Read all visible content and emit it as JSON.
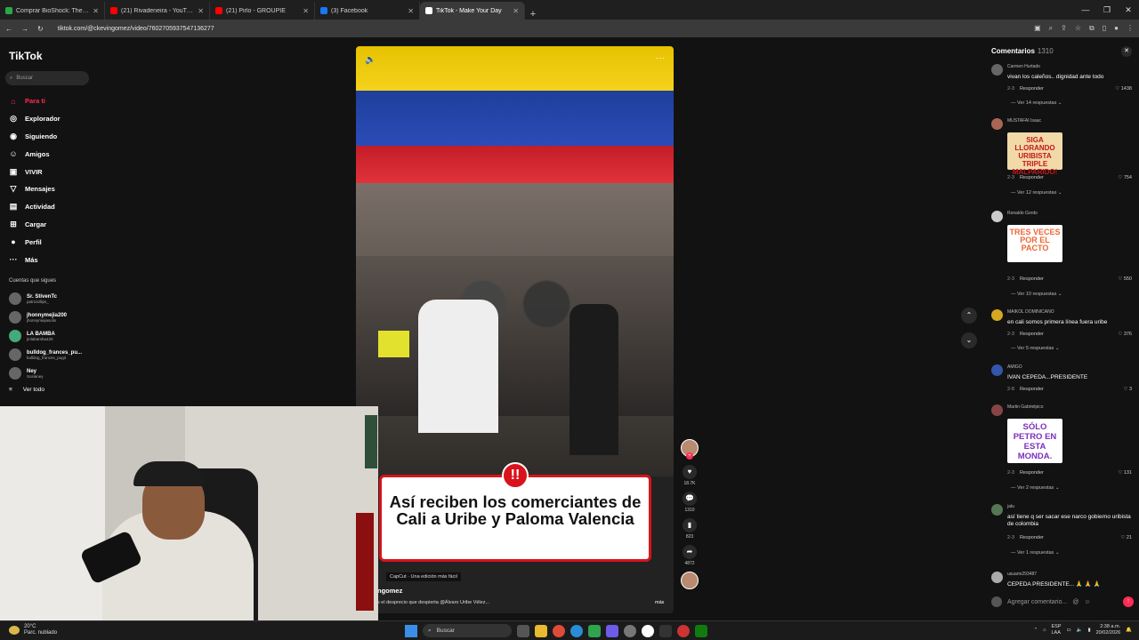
{
  "browser": {
    "tabs": [
      {
        "label": "Comprar BioShock: The Collection",
        "color": "#2aa845"
      },
      {
        "label": "(21) Rivadeneira - YouTube",
        "color": "#ff0000"
      },
      {
        "label": "(21) Pirlo - GROUPIE",
        "color": "#ff0000"
      },
      {
        "label": "(3) Facebook",
        "color": "#1877f2"
      },
      {
        "label": "TikTok - Make Your Day",
        "color": "#ffffff"
      }
    ],
    "url": "tiktok.com/@ckevingomez/video/7602705937547136277"
  },
  "sidebar": {
    "logo": "TikTok",
    "search_placeholder": "Buscar",
    "nav": [
      {
        "label": "Para ti",
        "icon": "home-icon",
        "glyph": "⌂"
      },
      {
        "label": "Explorador",
        "icon": "compass-icon",
        "glyph": "◎"
      },
      {
        "label": "Siguiendo",
        "icon": "following-icon",
        "glyph": "◉"
      },
      {
        "label": "Amigos",
        "icon": "friends-icon",
        "glyph": "☺"
      },
      {
        "label": "VIVIR",
        "icon": "live-icon",
        "glyph": "▣"
      },
      {
        "label": "Mensajes",
        "icon": "messages-icon",
        "glyph": "▽"
      },
      {
        "label": "Actividad",
        "icon": "activity-icon",
        "glyph": "▤"
      },
      {
        "label": "Cargar",
        "icon": "upload-icon",
        "glyph": "⊞"
      },
      {
        "label": "Perfil",
        "icon": "profile-icon",
        "glyph": "●"
      },
      {
        "label": "Más",
        "icon": "more-icon",
        "glyph": "···"
      }
    ],
    "following_header": "Cuentas que sigues",
    "following": [
      {
        "name": "Sr. StivenTc",
        "handle": "patriciollips_"
      },
      {
        "name": "jhonnymejia200",
        "handle": "jhonnymejiasolis"
      },
      {
        "name": "LA BAMBA",
        "handle": "jmlabamba420"
      },
      {
        "name": "bulldog_frances_pu...",
        "handle": "bulldog_frances_pug3"
      },
      {
        "name": "Ney",
        "handle": "Sosianey"
      }
    ],
    "see_all": "Ver todo"
  },
  "video": {
    "caption": "Así reciben los comerciantes de Cali a Uribe y Paloma Valencia",
    "alert": "!!",
    "capcut": "CapCut · Una edición más fácil",
    "username": "ngomez",
    "description": "s el desprecio que despierta @Álvaro Uribe Vélez...",
    "more": "más"
  },
  "actions": {
    "likes": "18.7K",
    "comments": "1310",
    "saves": "823",
    "shares": "4872"
  },
  "comments": {
    "title": "Comentarios",
    "count": "1310",
    "items": [
      {
        "user": "Carmen Hurtado",
        "text": "vivan los caleños.. dignidad ante todo",
        "date": "2-3",
        "reply": "Responder",
        "likes": "1438",
        "replies": "Ver 14 respuestas"
      },
      {
        "user": "MUSTAFAI Isaac",
        "sticker": "SIGA LLORANDO URIBISTA TRIPLE MALPARIDO!",
        "date": "2-3",
        "reply": "Responder",
        "likes": "754",
        "replies": "Ver 12 respuestas"
      },
      {
        "user": "Ronaldo Gordo",
        "sticker": "TRES VECES POR EL PACTO",
        "date": "2-3",
        "reply": "Responder",
        "likes": "550",
        "replies": "Ver 10 respuestas"
      },
      {
        "user": "MAIKOL DOMINICANO",
        "text": "en cali somos primera línea fuera uribe",
        "date": "2-3",
        "reply": "Responder",
        "likes": "376",
        "replies": "Ver 5 respuestas"
      },
      {
        "user": "AMIGO",
        "text": "IVAN CEPEDA...PRESIDENTE",
        "date": "2-8",
        "reply": "Responder",
        "likes": "3"
      },
      {
        "user": "Martin Gabrielpico",
        "sticker": "SÓLO PETRO EN ESTA MONDA.",
        "date": "2-3",
        "reply": "Responder",
        "likes": "131",
        "replies": "Ver 2 respuestas"
      },
      {
        "user": "jatu",
        "text": "así tiene q ser sacar ese narco gobierno uribista de colombia",
        "date": "2-3",
        "reply": "Responder",
        "likes": "21",
        "replies": "Ver 1 respuestas"
      },
      {
        "user": "usuario293487",
        "text": "CEPEDA PRESIDENTE... 🙏 🙏 🙏"
      }
    ],
    "input_placeholder": "Agregar comentario..."
  },
  "taskbar": {
    "temp": "20°C",
    "weather": "Parc. nublado",
    "search": "Buscar",
    "lang": "ESP",
    "lang2": "LAA",
    "time": "2:38 a.m.",
    "date": "20/02/2026"
  }
}
